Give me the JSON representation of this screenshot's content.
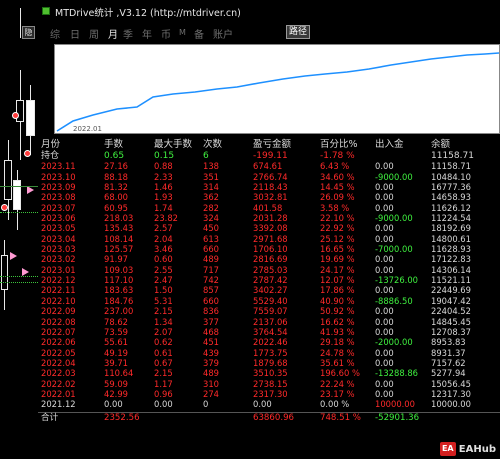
{
  "window": {
    "title": "MTDrive统计 ,V3.12 (http://mtdriver.cn)",
    "collapse_label": "隐"
  },
  "tabs": [
    {
      "label": "综",
      "active": false
    },
    {
      "label": "日",
      "active": false
    },
    {
      "label": "周",
      "active": false
    },
    {
      "label": "月",
      "active": true
    },
    {
      "label": "季",
      "active": false
    },
    {
      "label": "年",
      "active": false
    },
    {
      "label": "币",
      "active": false
    },
    {
      "label": "M",
      "active": false
    },
    {
      "label": "备",
      "active": false
    },
    {
      "label": "账户",
      "active": false
    }
  ],
  "path_button": "路径",
  "equity_chart": {
    "start_label": "2022.01",
    "line_color": "#1e90ff"
  },
  "table": {
    "headers": {
      "period": "月份",
      "lots": "手数",
      "max_lots": "最大手数",
      "trades": "次数",
      "profit": "盈亏金额",
      "percent": "百分比%",
      "in_out": "出入金",
      "balance": "余额"
    },
    "holding": {
      "period": "持仓",
      "lots": "0.65",
      "max_lots": "0.15",
      "trades": "6",
      "profit": "-199.11",
      "percent": "-1.78 %",
      "in_out": "",
      "balance": "11158.71"
    },
    "rows": [
      {
        "period": "2023.11",
        "lots": "27.16",
        "max_lots": "0.88",
        "trades": "138",
        "profit": "674.61",
        "percent": "6.43 %",
        "in_out": "0.00",
        "balance": "11158.71"
      },
      {
        "period": "2023.10",
        "lots": "88.18",
        "max_lots": "2.33",
        "trades": "351",
        "profit": "2766.74",
        "percent": "34.60 %",
        "in_out": "-9000.00",
        "balance": "10484.10"
      },
      {
        "period": "2023.09",
        "lots": "81.32",
        "max_lots": "1.46",
        "trades": "314",
        "profit": "2118.43",
        "percent": "14.45 %",
        "in_out": "0.00",
        "balance": "16777.36"
      },
      {
        "period": "2023.08",
        "lots": "68.00",
        "max_lots": "1.93",
        "trades": "362",
        "profit": "3032.81",
        "percent": "26.09 %",
        "in_out": "0.00",
        "balance": "14658.93"
      },
      {
        "period": "2023.07",
        "lots": "60.95",
        "max_lots": "1.74",
        "trades": "282",
        "profit": "401.58",
        "percent": "3.58 %",
        "in_out": "0.00",
        "balance": "11626.12"
      },
      {
        "period": "2023.06",
        "lots": "218.03",
        "max_lots": "23.82",
        "trades": "324",
        "profit": "2031.28",
        "percent": "22.10 %",
        "in_out": "-9000.00",
        "balance": "11224.54"
      },
      {
        "period": "2023.05",
        "lots": "135.43",
        "max_lots": "2.57",
        "trades": "450",
        "profit": "3392.08",
        "percent": "22.92 %",
        "in_out": "0.00",
        "balance": "18192.69"
      },
      {
        "period": "2023.04",
        "lots": "108.14",
        "max_lots": "2.04",
        "trades": "613",
        "profit": "2971.68",
        "percent": "25.12 %",
        "in_out": "0.00",
        "balance": "14800.61"
      },
      {
        "period": "2023.03",
        "lots": "125.57",
        "max_lots": "3.46",
        "trades": "660",
        "profit": "1706.10",
        "percent": "16.65 %",
        "in_out": "-7000.00",
        "balance": "11628.93"
      },
      {
        "period": "2023.02",
        "lots": "91.97",
        "max_lots": "0.60",
        "trades": "489",
        "profit": "2816.69",
        "percent": "19.69 %",
        "in_out": "0.00",
        "balance": "17122.83"
      },
      {
        "period": "2023.01",
        "lots": "109.03",
        "max_lots": "2.55",
        "trades": "717",
        "profit": "2785.03",
        "percent": "24.17 %",
        "in_out": "0.00",
        "balance": "14306.14"
      },
      {
        "period": "2022.12",
        "lots": "117.10",
        "max_lots": "2.47",
        "trades": "742",
        "profit": "2787.42",
        "percent": "12.07 %",
        "in_out": "-13726.00",
        "balance": "11521.11"
      },
      {
        "period": "2022.11",
        "lots": "183.63",
        "max_lots": "1.50",
        "trades": "857",
        "profit": "3402.27",
        "percent": "17.86 %",
        "in_out": "0.00",
        "balance": "22449.69"
      },
      {
        "period": "2022.10",
        "lots": "184.76",
        "max_lots": "5.31",
        "trades": "660",
        "profit": "5529.40",
        "percent": "40.90 %",
        "in_out": "-8886.50",
        "balance": "19047.42"
      },
      {
        "period": "2022.09",
        "lots": "237.00",
        "max_lots": "2.15",
        "trades": "836",
        "profit": "7559.07",
        "percent": "50.92 %",
        "in_out": "0.00",
        "balance": "22404.52"
      },
      {
        "period": "2022.08",
        "lots": "78.62",
        "max_lots": "1.34",
        "trades": "377",
        "profit": "2137.06",
        "percent": "16.62 %",
        "in_out": "0.00",
        "balance": "14845.45"
      },
      {
        "period": "2022.07",
        "lots": "73.59",
        "max_lots": "2.07",
        "trades": "468",
        "profit": "3764.54",
        "percent": "41.93 %",
        "in_out": "0.00",
        "balance": "12708.37"
      },
      {
        "period": "2022.06",
        "lots": "55.61",
        "max_lots": "0.62",
        "trades": "451",
        "profit": "2022.46",
        "percent": "29.18 %",
        "in_out": "-2000.00",
        "balance": "8953.83"
      },
      {
        "period": "2022.05",
        "lots": "49.19",
        "max_lots": "0.61",
        "trades": "439",
        "profit": "1773.75",
        "percent": "24.78 %",
        "in_out": "0.00",
        "balance": "8931.37"
      },
      {
        "period": "2022.04",
        "lots": "39.71",
        "max_lots": "0.67",
        "trades": "379",
        "profit": "1879.68",
        "percent": "35.61 %",
        "in_out": "0.00",
        "balance": "7157.62"
      },
      {
        "period": "2022.03",
        "lots": "110.64",
        "max_lots": "2.15",
        "trades": "489",
        "profit": "3510.35",
        "percent": "196.60 %",
        "in_out": "-13288.86",
        "balance": "5277.94"
      },
      {
        "period": "2022.02",
        "lots": "59.09",
        "max_lots": "1.17",
        "trades": "310",
        "profit": "2738.15",
        "percent": "22.24 %",
        "in_out": "0.00",
        "balance": "15056.45"
      },
      {
        "period": "2022.01",
        "lots": "42.99",
        "max_lots": "0.96",
        "trades": "274",
        "profit": "2317.30",
        "percent": "23.17 %",
        "in_out": "0.00",
        "balance": "12317.30"
      },
      {
        "period": "2021.12",
        "lots": "0.00",
        "max_lots": "0.00",
        "trades": "0",
        "profit": "0.00",
        "percent": "0.00 %",
        "in_out": "10000.00",
        "balance": "10000.00"
      }
    ],
    "total": {
      "period": "合计",
      "lots": "2352.56",
      "max_lots": "",
      "trades": "",
      "profit": "63860.96",
      "percent": "748.51 %",
      "in_out": "-52901.36",
      "balance": ""
    }
  },
  "watermark": {
    "icon": "EA",
    "text": "EAHub"
  },
  "colors": {
    "positive": "#3ff03f",
    "negative": "#ff2a2a",
    "neutral": "#d8d8d8",
    "background": "#000000"
  }
}
